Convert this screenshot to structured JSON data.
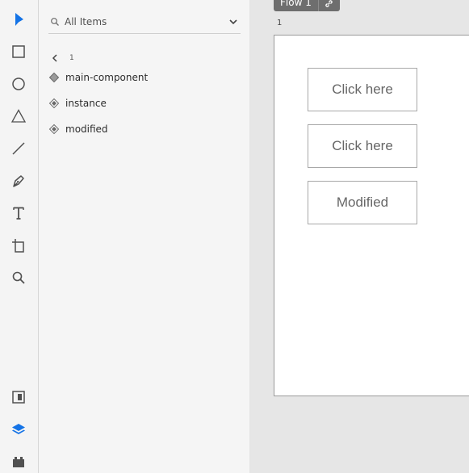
{
  "tools": [
    {
      "name": "select-arrow-icon",
      "active": true
    },
    {
      "name": "rectangle-icon"
    },
    {
      "name": "ellipse-icon"
    },
    {
      "name": "triangle-icon"
    },
    {
      "name": "line-icon"
    },
    {
      "name": "pen-icon"
    },
    {
      "name": "text-icon"
    },
    {
      "name": "artboard-icon"
    },
    {
      "name": "zoom-icon"
    }
  ],
  "bottom_tools": [
    {
      "name": "assets-icon"
    },
    {
      "name": "layers-icon",
      "active": true
    },
    {
      "name": "plugins-icon"
    }
  ],
  "panel": {
    "search": {
      "placeholder": "All Items"
    },
    "breadcrumb": {
      "text": "1"
    },
    "layers": [
      {
        "label": "main-component"
      },
      {
        "label": "instance"
      },
      {
        "label": "modified"
      }
    ]
  },
  "canvas": {
    "flow_label": "Flow 1",
    "artboard_label": "1",
    "buttons": [
      {
        "label": "Click here"
      },
      {
        "label": "Click here"
      },
      {
        "label": "Modified"
      }
    ]
  },
  "colors": {
    "accent": "#1473e6",
    "icon": "#505050"
  }
}
